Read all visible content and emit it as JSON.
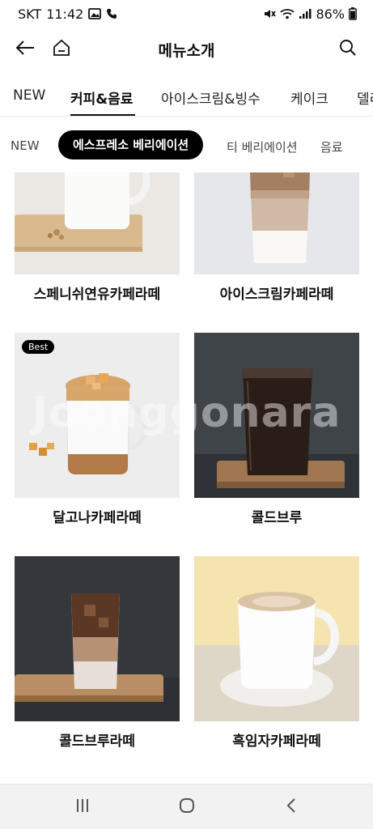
{
  "status_bar": {
    "carrier": "SKT",
    "time": "11:42",
    "battery": "86%",
    "icons": [
      "gallery-icon",
      "phone-icon",
      "mute-icon",
      "wifi-icon",
      "signal-icon",
      "battery-icon"
    ]
  },
  "header": {
    "title": "메뉴소개",
    "back_icon": "back-arrow-icon",
    "home_icon": "home-icon",
    "search_icon": "search-icon"
  },
  "category_tabs": [
    {
      "label": "NEW",
      "active": false
    },
    {
      "label": "커피&음료",
      "active": true
    },
    {
      "label": "아이스크림&빙수",
      "active": false
    },
    {
      "label": "케이크",
      "active": false
    },
    {
      "label": "델리",
      "active": false
    }
  ],
  "sub_tabs": [
    {
      "label": "NEW",
      "active": false
    },
    {
      "label": "에스프레소 베리에이션",
      "active": true
    },
    {
      "label": "티 베리에이션",
      "active": false
    },
    {
      "label": "음료",
      "active": false
    }
  ],
  "products": [
    {
      "name": "스페니쉬연유카페라떼",
      "badge": null
    },
    {
      "name": "아이스크림카페라떼",
      "badge": null
    },
    {
      "name": "달고나카페라떼",
      "badge": "Best"
    },
    {
      "name": "콜드브루",
      "badge": null
    },
    {
      "name": "콜드브루라떼",
      "badge": null
    },
    {
      "name": "흑임자카페라떼",
      "badge": null
    }
  ],
  "watermark": "Joonggonara",
  "nav_bar": {
    "recents_icon": "recents-icon",
    "home_icon": "home-circle-icon",
    "back_icon": "back-chevron-icon"
  },
  "colors": {
    "accent": "#000000",
    "nav_bg": "#f2f2f2"
  }
}
